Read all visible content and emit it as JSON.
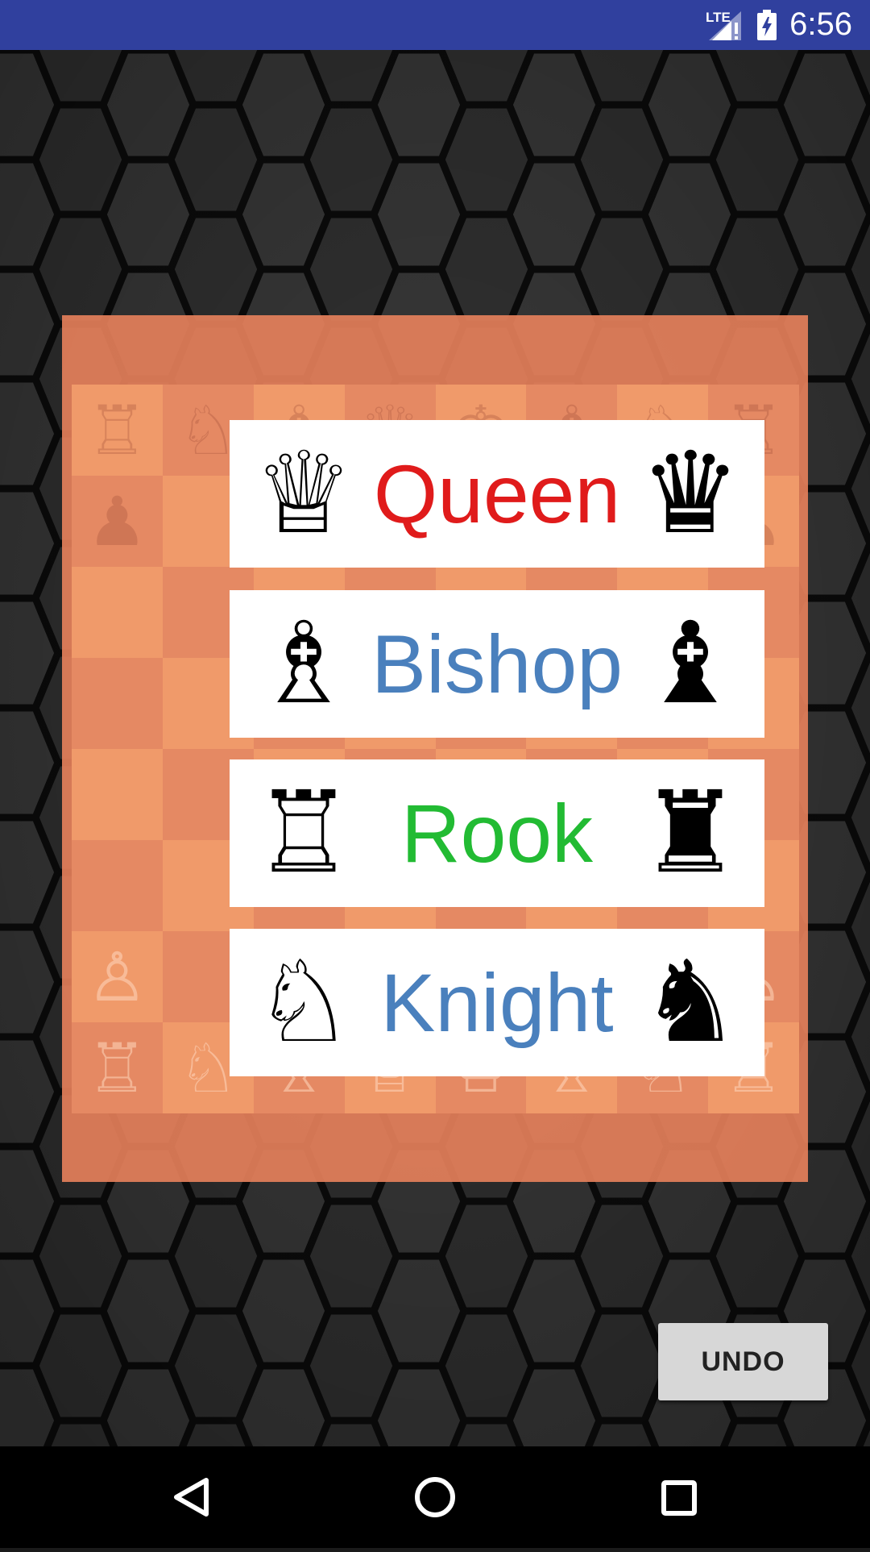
{
  "status_bar": {
    "time": "6:56",
    "network": "LTE",
    "icons": [
      "lte-signal-icon",
      "battery-charging-icon"
    ]
  },
  "board": {
    "row1": [
      "♖",
      "♘",
      "♗",
      "♕",
      "♔",
      "♗",
      "♘",
      "♖"
    ],
    "row2": [
      "♟",
      "",
      "",
      "",
      "",
      "",
      "",
      "♟"
    ],
    "row7": [
      "♙",
      "",
      "",
      "",
      "",
      "",
      "",
      "♙"
    ],
    "row8": [
      "♖",
      "♘",
      "♗",
      "♕",
      "♔",
      "♗",
      "♘",
      "♖"
    ]
  },
  "promotion": {
    "options": [
      {
        "label": "Queen",
        "white_icon": "♕",
        "black_icon": "♛",
        "color": "#e01b1b"
      },
      {
        "label": "Bishop",
        "white_icon": "♗",
        "black_icon": "♝",
        "color": "#4a80bd"
      },
      {
        "label": "Rook",
        "white_icon": "♖",
        "black_icon": "♜",
        "color": "#22bb33"
      },
      {
        "label": "Knight",
        "white_icon": "♘",
        "black_icon": "♞",
        "color": "#4a80bd"
      }
    ]
  },
  "undo_label": "UNDO",
  "nav": {
    "icons": [
      "back-icon",
      "home-icon",
      "recents-icon"
    ]
  }
}
